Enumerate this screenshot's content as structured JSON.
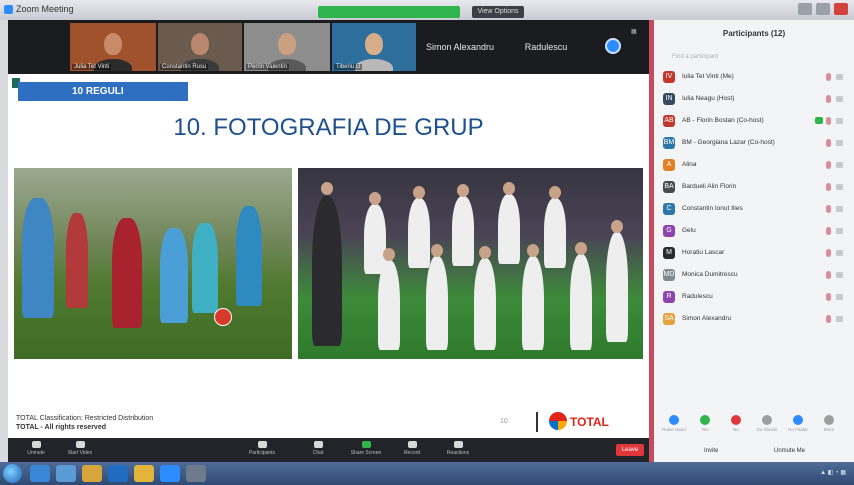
{
  "window": {
    "title": "Zoom Meeting",
    "view_options": "View Options"
  },
  "strip": {
    "thumbnails": [
      {
        "name": "Julia Tet Vinti",
        "bg": "#a0522d",
        "skin": "#c98c6b",
        "shirt": "#2b2b2b"
      },
      {
        "name": "Constantin Rusu",
        "bg": "#6b5a4e",
        "skin": "#b8876c",
        "shirt": "#3a3a3a"
      },
      {
        "name": "Perrin Valentin",
        "bg": "#8d8d8d",
        "skin": "#caa081",
        "shirt": "#5a5a5a"
      },
      {
        "name": "Tiberiu G",
        "bg": "#2e6e9c",
        "skin": "#d7ad8c",
        "shirt": "#b9b9b9"
      }
    ],
    "text_tiles": [
      "Simon Alexandru",
      "Radulescu"
    ]
  },
  "slide": {
    "banner": "10 REGULI",
    "title": "10. FOTOGRAFIA DE GRUP",
    "classification": "TOTAL Classification: Restricted Distribution",
    "classification2": "TOTAL - All rights reserved",
    "page_number": "10",
    "brand": "TOTAL"
  },
  "toolbar": {
    "items": [
      "Unmute",
      "Start Video",
      "Participants",
      "Chat",
      "Share Screen",
      "Record",
      "Reactions"
    ],
    "end": "Leave"
  },
  "participants": {
    "title": "Participants (12)",
    "search_placeholder": "Find a participant",
    "list": [
      {
        "name": "Iulia Tet Vinti (Me)",
        "initial": "IV",
        "color": "#c0392b",
        "mic": true,
        "green": false
      },
      {
        "name": "Iulia Neagu (Host)",
        "initial": "IN",
        "color": "#34495e",
        "mic": false,
        "green": false
      },
      {
        "name": "AB - Florin Bostan (Co-host)",
        "initial": "AB",
        "color": "#c0392b",
        "mic": false,
        "green": true
      },
      {
        "name": "BM - Georgiana Lazar (Co-host)",
        "initial": "BM",
        "color": "#2d78a8",
        "mic": false,
        "green": false
      },
      {
        "name": "Alina",
        "initial": "A",
        "color": "#e67e22",
        "mic": false,
        "green": false
      },
      {
        "name": "Bardueli Alin Florin",
        "initial": "BA",
        "color": "#4a4a4a",
        "mic": false,
        "green": false
      },
      {
        "name": "Constantin Ionut Ilies",
        "initial": "C",
        "color": "#2d78a8",
        "mic": false,
        "green": false
      },
      {
        "name": "Gelu",
        "initial": "G",
        "color": "#8e44ad",
        "mic": false,
        "green": false
      },
      {
        "name": "Horatiu Lascar",
        "initial": "M",
        "color": "#2b2b2b",
        "mic": false,
        "green": false
      },
      {
        "name": "Monica Dumitrescu",
        "initial": "MD",
        "color": "#7f8c8d",
        "mic": false,
        "green": false
      },
      {
        "name": "Radulescu",
        "initial": "R",
        "color": "#8e44ad",
        "mic": false,
        "green": false
      },
      {
        "name": "Simon Alexandru",
        "initial": "SA",
        "color": "#e6a23c",
        "mic": false,
        "green": false
      }
    ],
    "reactions": [
      {
        "label": "Raise Hand",
        "color": "#2d8cff"
      },
      {
        "label": "Yes",
        "color": "#2fb54b"
      },
      {
        "label": "No",
        "color": "#e0373a"
      },
      {
        "label": "Go Slower",
        "color": "#9e9e9e"
      },
      {
        "label": "Go Faster",
        "color": "#2d8cff"
      },
      {
        "label": "More",
        "color": "#9e9e9e"
      }
    ],
    "invite": "Invite",
    "mute_all": "Unmute Me"
  }
}
